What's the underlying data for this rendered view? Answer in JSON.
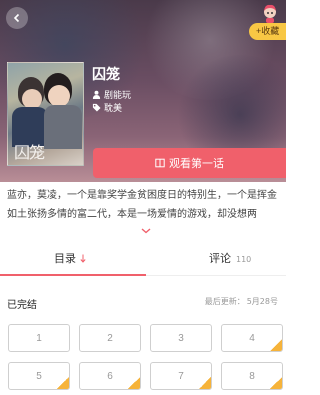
{
  "header": {
    "favorite_label": "+收藏",
    "cover_title": "囚笼",
    "title": "囚笼",
    "author": "剧能玩",
    "tag": "耽美",
    "read_button": "观看第一话"
  },
  "intro": "蓝亦，莫凌，一个是靠奖学金贫困度日的特别生，一个是挥金如土张扬多情的富二代，本是一场爱情的游戏，却没想两",
  "tabs": {
    "catalog_label": "目录",
    "comments_label": "评论",
    "comments_count": "110"
  },
  "status": {
    "state": "已完结",
    "updated_label": "最后更新：",
    "updated_date": "5月28号"
  },
  "chapters": [
    "1",
    "2",
    "3",
    "4",
    "5",
    "6",
    "7",
    "8"
  ],
  "colors": {
    "accent": "#f0606b",
    "favorite": "#f8c744",
    "lock": "#f6b33a"
  }
}
